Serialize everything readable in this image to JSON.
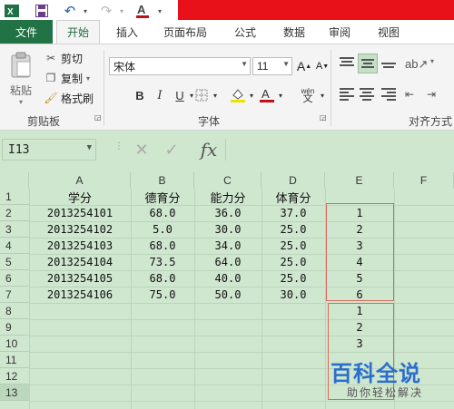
{
  "quick_access": {
    "app_icon": "excel-icon",
    "save_icon": "save-icon",
    "undo_icon": "undo-icon",
    "redo_icon": "redo-icon",
    "font_color_icon": "font-color-icon"
  },
  "tabs": {
    "file": "文件",
    "home": "开始",
    "insert": "插入",
    "page_layout": "页面布局",
    "formulas": "公式",
    "data": "数据",
    "review": "审阅",
    "view": "视图"
  },
  "ribbon": {
    "paste": "粘贴",
    "cut": "剪切",
    "copy": "复制",
    "format_painter": "格式刷",
    "clipboard_label": "剪贴板",
    "font_name": "宋体",
    "font_size": "11",
    "bold": "B",
    "italic": "I",
    "underline": "U",
    "wen": "wén",
    "wen_char": "文",
    "font_label": "字体",
    "alignment_label": "对齐方式"
  },
  "formula_bar": {
    "name_box": "I13",
    "fx": "fx",
    "cancel": "✕",
    "confirm": "✓"
  },
  "sheet": {
    "columns": [
      "A",
      "B",
      "C",
      "D",
      "E",
      "F"
    ],
    "rows": [
      "1",
      "2",
      "3",
      "4",
      "5",
      "6",
      "7",
      "8",
      "9",
      "10",
      "11",
      "12",
      "13"
    ],
    "header": [
      "学分",
      "德育分",
      "能力分",
      "体育分"
    ],
    "data": [
      [
        "2013254101",
        "68.0",
        "36.0",
        "37.0",
        "1"
      ],
      [
        "2013254102",
        "5.0",
        "30.0",
        "25.0",
        "2"
      ],
      [
        "2013254103",
        "68.0",
        "34.0",
        "25.0",
        "3"
      ],
      [
        "2013254104",
        "73.5",
        "64.0",
        "25.0",
        "4"
      ],
      [
        "2013254105",
        "68.0",
        "40.0",
        "25.0",
        "5"
      ],
      [
        "2013254106",
        "75.0",
        "50.0",
        "30.0",
        "6"
      ]
    ],
    "extra_e": [
      "1",
      "2",
      "3"
    ]
  },
  "watermark": {
    "logo": "百科全说",
    "sub": "助你轻松解决"
  }
}
